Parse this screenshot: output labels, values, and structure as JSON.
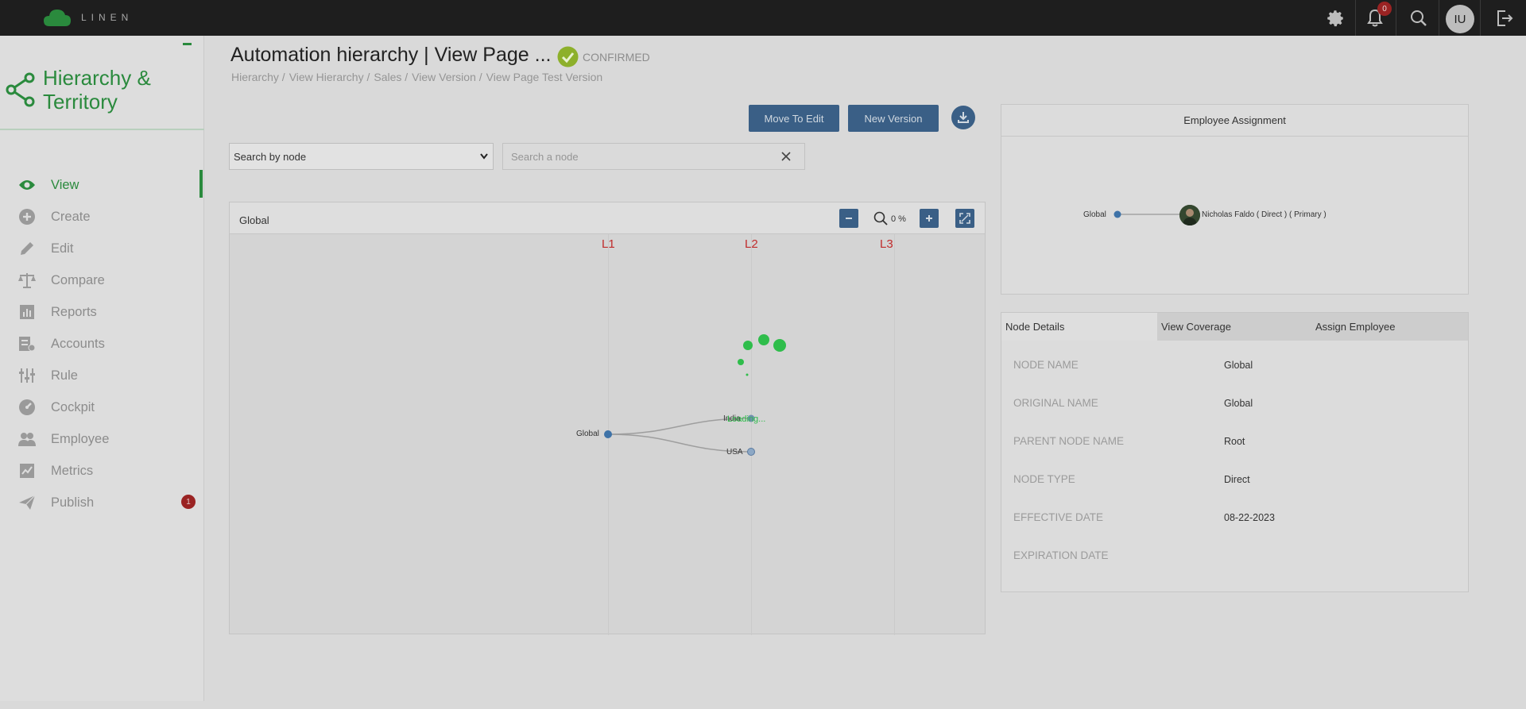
{
  "app": {
    "name": "LINEN",
    "module_title": "Hierarchy & Territory"
  },
  "topbar": {
    "notification_count": "0",
    "user_initials": "IU"
  },
  "sidebar": {
    "items": [
      {
        "label": "View",
        "icon": "eye-icon",
        "active": true
      },
      {
        "label": "Create",
        "icon": "plus-circle-icon"
      },
      {
        "label": "Edit",
        "icon": "pencil-icon"
      },
      {
        "label": "Compare",
        "icon": "scale-icon"
      },
      {
        "label": "Reports",
        "icon": "bar-chart-icon"
      },
      {
        "label": "Accounts",
        "icon": "accounts-icon"
      },
      {
        "label": "Rule",
        "icon": "sliders-icon"
      },
      {
        "label": "Cockpit",
        "icon": "gauge-icon"
      },
      {
        "label": "Employee",
        "icon": "users-icon"
      },
      {
        "label": "Metrics",
        "icon": "line-chart-icon"
      },
      {
        "label": "Publish",
        "icon": "paper-plane-icon",
        "badge": "1"
      }
    ]
  },
  "header": {
    "title": "Automation hierarchy | View Page ...",
    "status": "CONFIRMED",
    "breadcrumb": [
      "Hierarchy /",
      "View Hierarchy /",
      "Sales /",
      "View Version /",
      "View Page Test Version"
    ]
  },
  "actions": {
    "move_to_edit": "Move To Edit",
    "new_version": "New Version"
  },
  "search": {
    "select_value": "Search by node",
    "placeholder": "Search a node"
  },
  "tree": {
    "title": "Global",
    "zoom": "0 %",
    "levels": [
      "L1",
      "L2",
      "L3"
    ],
    "nodes": {
      "root": "Global",
      "child1": "India",
      "child2": "USA"
    },
    "loading_text": "Loading..."
  },
  "employee_assignment": {
    "title": "Employee Assignment",
    "node": "Global",
    "employee": "Nicholas Faldo ( Direct ) ( Primary )"
  },
  "node_details": {
    "tabs": [
      "Node Details",
      "View Coverage",
      "Assign Employee"
    ],
    "fields": [
      {
        "key": "NODE NAME",
        "value": "Global"
      },
      {
        "key": "ORIGINAL NAME",
        "value": "Global"
      },
      {
        "key": "PARENT NODE NAME",
        "value": "Root"
      },
      {
        "key": "NODE TYPE",
        "value": "Direct"
      },
      {
        "key": "EFFECTIVE DATE",
        "value": "08-22-2023"
      },
      {
        "key": "EXPIRATION DATE",
        "value": ""
      }
    ]
  },
  "colors": {
    "brand_green": "#2a8a3d",
    "primary_button": "#3a5f86",
    "level_red": "#c02b2b",
    "badge_red": "#9a2323"
  }
}
